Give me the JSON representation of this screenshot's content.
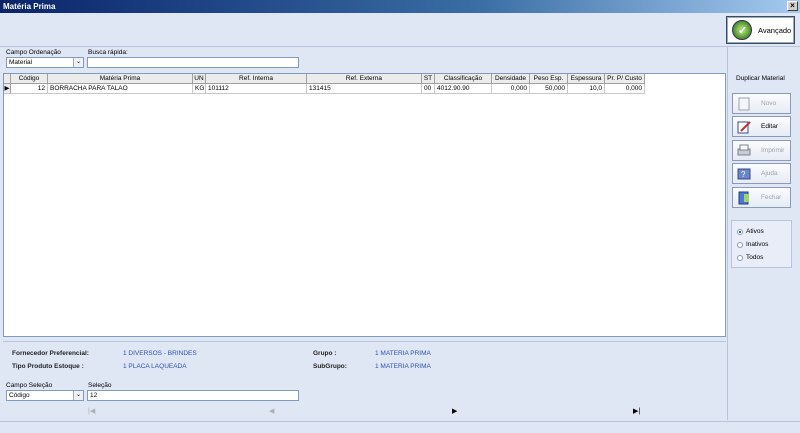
{
  "window": {
    "title": "Matéria Prima",
    "close_glyph": "×"
  },
  "toolbar": {
    "advanced_label": "Avançado"
  },
  "search": {
    "order_label": "Campo Ordenação",
    "order_value": "Material",
    "quick_label": "Busca rápida:",
    "quick_value": ""
  },
  "grid": {
    "columns": [
      "Código",
      "Matéria Prima",
      "UN",
      "Ref. Interna",
      "Ref. Externa",
      "ST",
      "Classificação",
      "Densidade",
      "Peso Esp.",
      "Espessura",
      "Pr. P/ Custo"
    ],
    "rows": [
      [
        "12",
        "BORRACHA PARA TALAO",
        "KG",
        "101112",
        "131415",
        "00",
        "4012.90.90",
        "0,000",
        "50,000",
        "10,0",
        "0,000"
      ]
    ],
    "row_indicator": "▶"
  },
  "info": {
    "supplier_label": "Fornecedor Preferencial:",
    "supplier_value": "1 DIVERSOS  - BRINDES",
    "product_type_label": "Tipo Produto Estoque   :",
    "product_type_value": "1 PLACA LAQUEADA",
    "group_label": "Grupo       :",
    "group_value": "1 MATERIA PRIMA",
    "subgroup_label": "SubGrupo:",
    "subgroup_value": "1 MATERIA PRIMA"
  },
  "selection": {
    "field_label": "Campo Seleção",
    "field_value": "Código",
    "value_label": "Seleção",
    "value": "12"
  },
  "nav": {
    "first": "|◀",
    "prev": "◀",
    "next": "▶",
    "last": "▶|"
  },
  "side": {
    "duplicate_label": "Duplicar Material",
    "buttons": {
      "new": "Novo",
      "edit": "Editar",
      "print": "Imprimir",
      "help": "Ajuda",
      "close": "Fechar"
    },
    "filters": {
      "active": "Ativos",
      "inactive": "Inativos",
      "all": "Todos",
      "selected": "active"
    }
  },
  "colors": {
    "accent": "#0a246a",
    "info_value": "#3050b0",
    "panel_bg": "#dfe6f4"
  }
}
